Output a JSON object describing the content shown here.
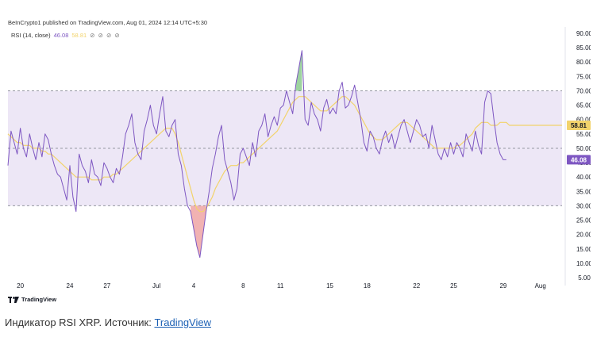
{
  "header": {
    "published": "BeInCrypto1 published on TradingView.com, Aug 01, 2024 12:14 UTC+5:30",
    "indicator_label": "RSI (14, close)",
    "rsi_value": "46.08",
    "ma_value": "58.81",
    "icons": [
      "eye-icon",
      "settings-icon",
      "delete-icon",
      "more-icon"
    ]
  },
  "footer": {
    "logo_text": "TradingView",
    "caption_text": "Индикатор RSI XRP. Источник: ",
    "caption_link": "TradingView"
  },
  "colors": {
    "rsi": "#7e57c2",
    "ma": "#f2d36b",
    "band_fill": "#ede7f6",
    "overbought_fill": "#4caf50",
    "oversold_fill": "#e57373",
    "grid": "#9598a1"
  },
  "chart_data": {
    "type": "line",
    "title": "",
    "ylim": [
      5,
      90
    ],
    "yticks": [
      90,
      85,
      80,
      75,
      70,
      65,
      60,
      55,
      50,
      45,
      40,
      35,
      30,
      25,
      20,
      15,
      10,
      5
    ],
    "ytick_labels": [
      "90.00",
      "85.00",
      "80.00",
      "75.00",
      "70.00",
      "65.00",
      "60.00",
      "55.00",
      "50.00",
      "45.00",
      "40.00",
      "35.00",
      "30.00",
      "25.00",
      "20.00",
      "15.00",
      "10.00",
      "5.00"
    ],
    "xticks": [
      {
        "label": "20",
        "i": 4
      },
      {
        "label": "24",
        "i": 20
      },
      {
        "label": "27",
        "i": 32
      },
      {
        "label": "Jul",
        "i": 48
      },
      {
        "label": "4",
        "i": 60
      },
      {
        "label": "8",
        "i": 76
      },
      {
        "label": "11",
        "i": 88
      },
      {
        "label": "15",
        "i": 104
      },
      {
        "label": "18",
        "i": 116
      },
      {
        "label": "22",
        "i": 132
      },
      {
        "label": "25",
        "i": 144
      },
      {
        "label": "29",
        "i": 160
      },
      {
        "label": "Aug",
        "i": 172
      }
    ],
    "x_count": 180,
    "bands": {
      "upper": 70,
      "middle": 50,
      "lower": 30
    },
    "last_labels": [
      {
        "text": "58.81",
        "series": "MA"
      },
      {
        "text": "46.08",
        "series": "RSI"
      }
    ],
    "series": [
      {
        "values": [
          44,
          56,
          52,
          48,
          57,
          50,
          47,
          55,
          50,
          46,
          52,
          47,
          55,
          53,
          48,
          44,
          41,
          40,
          36,
          32,
          44,
          33,
          28,
          48,
          44,
          42,
          38,
          46,
          41,
          40,
          37,
          45,
          43,
          40,
          38,
          43,
          41,
          47,
          55,
          58,
          62,
          52,
          48,
          46,
          56,
          60,
          65,
          58,
          55,
          62,
          68,
          56,
          54,
          58,
          60,
          48,
          44,
          36,
          30,
          28,
          22,
          16,
          12,
          20,
          28,
          35,
          43,
          48,
          54,
          58,
          46,
          42,
          38,
          32,
          36,
          48,
          50,
          47,
          44,
          52,
          47,
          56,
          58,
          62,
          54,
          58,
          61,
          58,
          64,
          65,
          70,
          66,
          62,
          72,
          78,
          84,
          60,
          58,
          66,
          62,
          60,
          56,
          64,
          67,
          62,
          64,
          62,
          70,
          73,
          64,
          65,
          68,
          72,
          66,
          60,
          52,
          49,
          56,
          54,
          50,
          48,
          53,
          56,
          52,
          55,
          50,
          54,
          58,
          60,
          56,
          52,
          56,
          60,
          58,
          54,
          55,
          50,
          58,
          53,
          48,
          46,
          50,
          47,
          52,
          48,
          52,
          50,
          47,
          55,
          52,
          49,
          56,
          51,
          48,
          66,
          70,
          69,
          60,
          52,
          48,
          46,
          46
        ]
      },
      {
        "values": [
          55,
          54,
          53,
          52,
          52,
          51,
          51,
          51,
          50,
          50,
          50,
          49,
          49,
          48,
          48,
          47,
          46,
          45,
          44,
          43,
          42,
          41,
          40,
          40,
          40,
          40,
          40,
          39,
          39,
          39,
          39,
          40,
          40,
          40,
          41,
          41,
          42,
          43,
          44,
          45,
          46,
          47,
          48,
          49,
          50,
          51,
          52,
          53,
          54,
          55,
          56,
          57,
          57,
          57,
          55,
          52,
          48,
          44,
          40,
          36,
          32,
          29,
          28,
          28,
          29,
          31,
          33,
          36,
          38,
          40,
          42,
          43,
          44,
          44,
          44,
          45,
          45,
          46,
          47,
          48,
          49,
          50,
          51,
          52,
          53,
          54,
          55,
          56,
          58,
          60,
          62,
          64,
          66,
          67,
          68,
          68,
          68,
          67,
          66,
          65,
          64,
          63,
          63,
          63,
          64,
          65,
          66,
          67,
          68,
          68,
          67,
          66,
          65,
          63,
          61,
          59,
          57,
          55,
          54,
          53,
          53,
          53,
          54,
          55,
          56,
          57,
          58,
          59,
          59,
          59,
          58,
          57,
          56,
          55,
          54,
          53,
          52,
          51,
          50,
          50,
          50,
          50,
          50,
          50,
          50,
          51,
          51,
          52,
          53,
          54,
          55,
          57,
          58,
          59,
          59,
          59,
          58,
          58,
          58,
          59,
          59,
          59,
          58,
          58,
          58,
          58,
          58,
          58,
          58,
          58,
          58,
          58,
          58,
          58,
          58,
          58,
          58,
          58,
          58,
          58
        ]
      }
    ]
  }
}
